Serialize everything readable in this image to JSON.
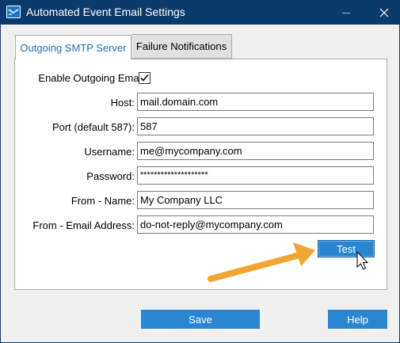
{
  "window": {
    "title": "Automated Event Email Settings"
  },
  "tabs": [
    {
      "label": "Outgoing SMTP Server",
      "active": true
    },
    {
      "label": "Failure Notifications",
      "active": false
    }
  ],
  "form": {
    "enable_label": "Enable Outgoing Email:",
    "enable_checked": true,
    "host_label": "Host:",
    "host_value": "mail.domain.com",
    "port_label": "Port (default 587):",
    "port_value": "587",
    "username_label": "Username:",
    "username_value": "me@mycompany.com",
    "password_label": "Password:",
    "password_value": "********************",
    "from_name_label": "From - Name:",
    "from_name_value": "My Company LLC",
    "from_email_label": "From - Email Address:",
    "from_email_value": "do-not-reply@mycompany.com"
  },
  "buttons": {
    "test": "Test",
    "save": "Save",
    "help": "Help"
  },
  "colors": {
    "accent": "#2a86d0",
    "titlebar": "#0b3b6b",
    "arrow": "#f2a531"
  },
  "icons": {
    "app": "mail-window-icon",
    "minimize": "minimize-icon",
    "close": "close-icon",
    "check": "check-icon",
    "cursor": "mouse-pointer-icon",
    "annotation": "orange-arrow-icon"
  }
}
